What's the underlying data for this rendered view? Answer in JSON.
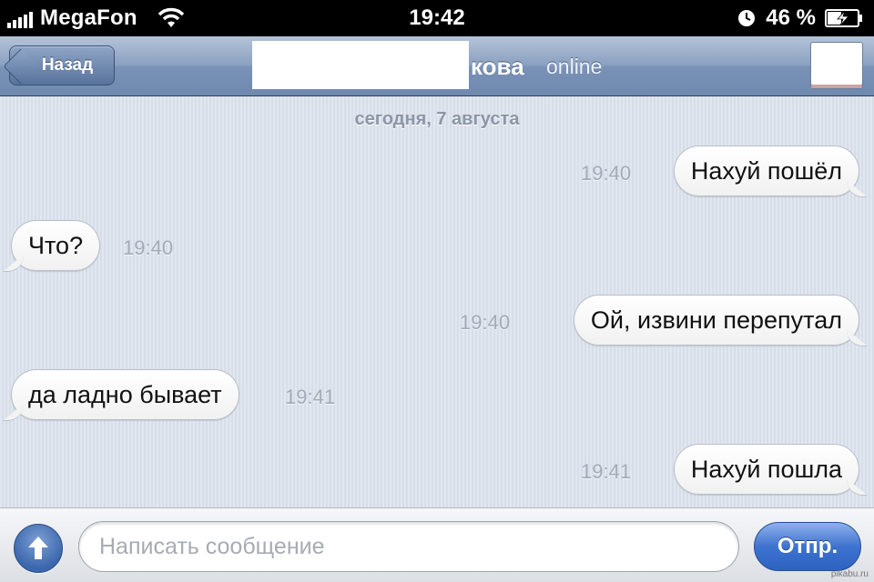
{
  "status_bar": {
    "carrier": "MegaFon",
    "time": "19:42",
    "battery": "46 %"
  },
  "nav": {
    "back_label": "Назад",
    "contact_name_suffix": "кова",
    "contact_status": "online"
  },
  "chat": {
    "date_label": "сегодня, 7 августа",
    "messages": [
      {
        "direction": "outgoing",
        "text": "Нахуй пошёл",
        "time": "19:40"
      },
      {
        "direction": "incoming",
        "text": "Что?",
        "time": "19:40"
      },
      {
        "direction": "outgoing",
        "text": "Ой, извини перепутал",
        "time": "19:40"
      },
      {
        "direction": "incoming",
        "text": "да ладно бывает",
        "time": "19:41"
      },
      {
        "direction": "outgoing",
        "text": "Нахуй пошла",
        "time": "19:41"
      }
    ]
  },
  "input_bar": {
    "placeholder": "Написать сообщение",
    "send_label": "Отпр."
  },
  "watermark": "pikabu.ru",
  "colors": {
    "nav_bar": "#7a92b6",
    "chat_background": "#dbe2ed",
    "send_button": "#3f73cf"
  }
}
